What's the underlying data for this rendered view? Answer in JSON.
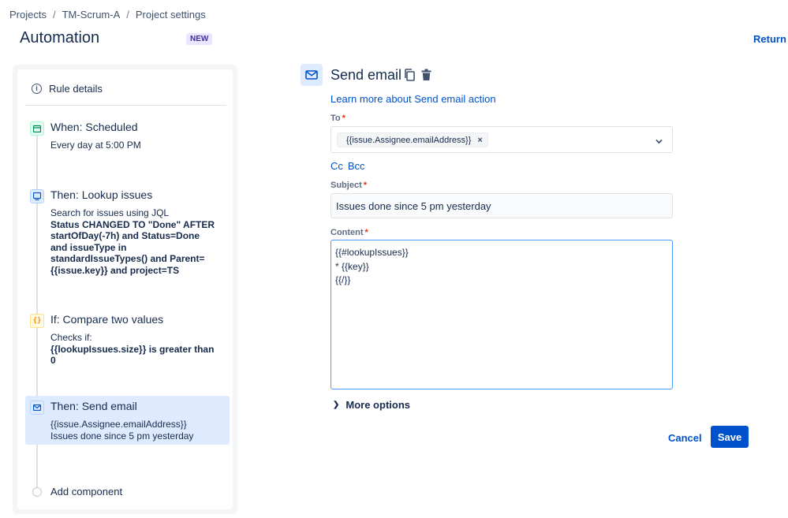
{
  "breadcrumb": {
    "items": [
      "Projects",
      "TM-Scrum-A",
      "Project settings"
    ],
    "separator": "/"
  },
  "header": {
    "title": "Automation",
    "badge": "NEW",
    "return_link": "Return t"
  },
  "sidebar": {
    "rule_details": "Rule details",
    "steps": [
      {
        "icon": "calendar-icon",
        "title": "When: Scheduled",
        "lines": [
          "Every day at 5:00 PM"
        ]
      },
      {
        "icon": "lookup-issues-icon",
        "title": "Then: Lookup issues",
        "intro": "Search for issues using JQL",
        "bold_lines": [
          "Status CHANGED TO \"Done\" AFTER",
          "startOfDay(-7h) and Status=Done",
          "and issueType in",
          "standardIssueTypes() and Parent=",
          "{{issue.key}} and project=TS"
        ]
      },
      {
        "icon": "braces-icon",
        "icon_glyph": "{}",
        "title": "If: Compare two values",
        "intro": "Checks if:",
        "bold_lines": [
          "{{lookupIssues.size}} is greater than",
          "0"
        ]
      },
      {
        "icon": "mail-icon",
        "title": "Then: Send email",
        "lines": [
          "{{issue.Assignee.emailAddress}}",
          "Issues done since 5 pm yesterday"
        ],
        "active": true
      }
    ],
    "add_component": "Add component"
  },
  "editor": {
    "title": "Send email",
    "learn_more": "Learn more about Send email action",
    "to_label": "To",
    "to_tag": "{{issue.Assignee.emailAddress}}",
    "to_tag_remove": "×",
    "cc": "Cc",
    "bcc": "Bcc",
    "subject_label": "Subject",
    "subject_value": "Issues done since 5 pm yesterday",
    "content_label": "Content",
    "content_value": "{{#lookupIssues}}\n* {{key}}\n{{/}}",
    "required_marker": "*",
    "more_options": "More options",
    "cancel": "Cancel",
    "save": "Save"
  },
  "colors": {
    "accent": "#0052cc",
    "active_step_bg": "#deebff",
    "required": "#de350b",
    "focus_border": "#4c9aff"
  }
}
